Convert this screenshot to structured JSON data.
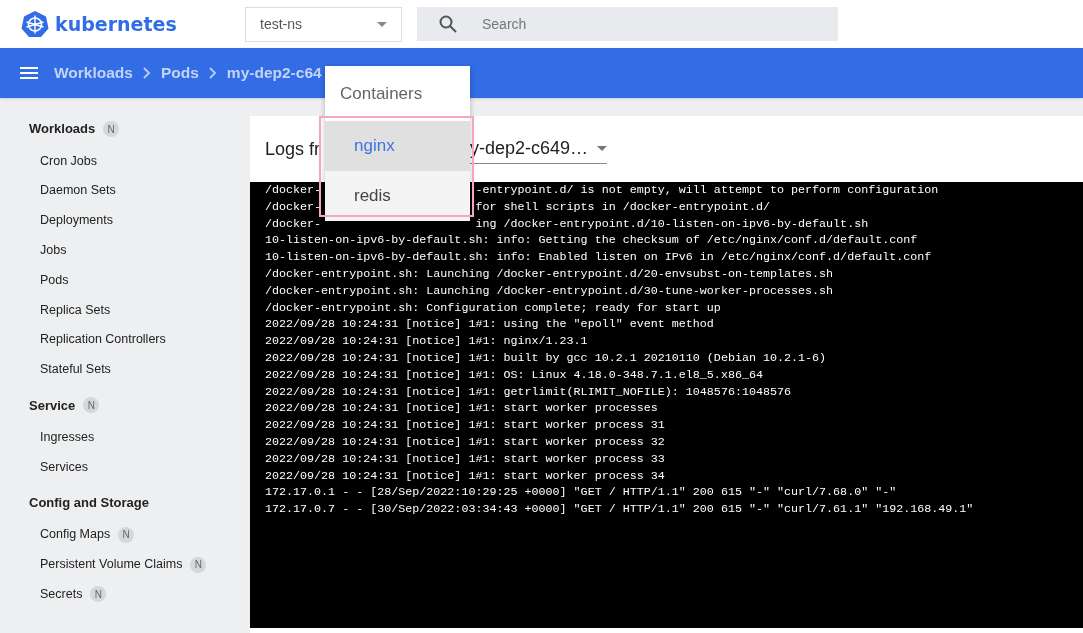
{
  "header": {
    "brand": "kubernetes",
    "namespace": "test-ns",
    "search": {
      "placeholder": "Search"
    }
  },
  "breadcrumbs": [
    "Workloads",
    "Pods",
    "my-dep2-c64"
  ],
  "sidebar": [
    {
      "title": "Workloads",
      "badge": "N",
      "items": [
        {
          "label": "Cron Jobs"
        },
        {
          "label": "Daemon Sets"
        },
        {
          "label": "Deployments"
        },
        {
          "label": "Jobs"
        },
        {
          "label": "Pods"
        },
        {
          "label": "Replica Sets"
        },
        {
          "label": "Replication Controllers"
        },
        {
          "label": "Stateful Sets"
        }
      ]
    },
    {
      "title": "Service",
      "badge": "N",
      "items": [
        {
          "label": "Ingresses"
        },
        {
          "label": "Services"
        }
      ]
    },
    {
      "title": "Config and Storage",
      "items": [
        {
          "label": "Config Maps",
          "badge": "N"
        },
        {
          "label": "Persistent Volume Claims",
          "badge": "N"
        },
        {
          "label": "Secrets",
          "badge": "N"
        }
      ]
    }
  ],
  "logs": {
    "label": "Logs fr",
    "pod_select": "y-dep2-c649…",
    "lines": [
      {
        "left": "/docker-",
        "right": "-entrypoint.d/ is not empty, will attempt to perform configuration"
      },
      {
        "left": "/docker-",
        "right": "for shell scripts in /docker-entrypoint.d/"
      },
      {
        "left": "/docker-",
        "right": "ing /docker-entrypoint.d/10-listen-on-ipv6-by-default.sh"
      },
      {
        "text": "10-listen-on-ipv6-by-default.sh: info: Getting the checksum of /etc/nginx/conf.d/default.conf"
      },
      {
        "text": "10-listen-on-ipv6-by-default.sh: info: Enabled listen on IPv6 in /etc/nginx/conf.d/default.conf"
      },
      {
        "text": "/docker-entrypoint.sh: Launching /docker-entrypoint.d/20-envsubst-on-templates.sh"
      },
      {
        "text": "/docker-entrypoint.sh: Launching /docker-entrypoint.d/30-tune-worker-processes.sh"
      },
      {
        "text": "/docker-entrypoint.sh: Configuration complete; ready for start up"
      },
      {
        "text": "2022/09/28 10:24:31 [notice] 1#1: using the \"epoll\" event method"
      },
      {
        "text": "2022/09/28 10:24:31 [notice] 1#1: nginx/1.23.1"
      },
      {
        "text": "2022/09/28 10:24:31 [notice] 1#1: built by gcc 10.2.1 20210110 (Debian 10.2.1-6)"
      },
      {
        "text": "2022/09/28 10:24:31 [notice] 1#1: OS: Linux 4.18.0-348.7.1.el8_5.x86_64"
      },
      {
        "text": "2022/09/28 10:24:31 [notice] 1#1: getrlimit(RLIMIT_NOFILE): 1048576:1048576"
      },
      {
        "text": "2022/09/28 10:24:31 [notice] 1#1: start worker processes"
      },
      {
        "text": "2022/09/28 10:24:31 [notice] 1#1: start worker process 31"
      },
      {
        "text": "2022/09/28 10:24:31 [notice] 1#1: start worker process 32"
      },
      {
        "text": "2022/09/28 10:24:31 [notice] 1#1: start worker process 33"
      },
      {
        "text": "2022/09/28 10:24:31 [notice] 1#1: start worker process 34"
      },
      {
        "text": "172.17.0.1 - - [28/Sep/2022:10:29:25 +0000] \"GET / HTTP/1.1\" 200 615 \"-\" \"curl/7.68.0\" \"-\""
      },
      {
        "text": "172.17.0.7 - - [30/Sep/2022:03:34:43 +0000] \"GET / HTTP/1.1\" 200 615 \"-\" \"curl/7.61.1\" \"192.168.49.1\""
      }
    ]
  },
  "containers_menu": {
    "title": "Containers",
    "items": [
      {
        "label": "nginx",
        "selected": true
      },
      {
        "label": "redis",
        "selected": false
      }
    ]
  }
}
